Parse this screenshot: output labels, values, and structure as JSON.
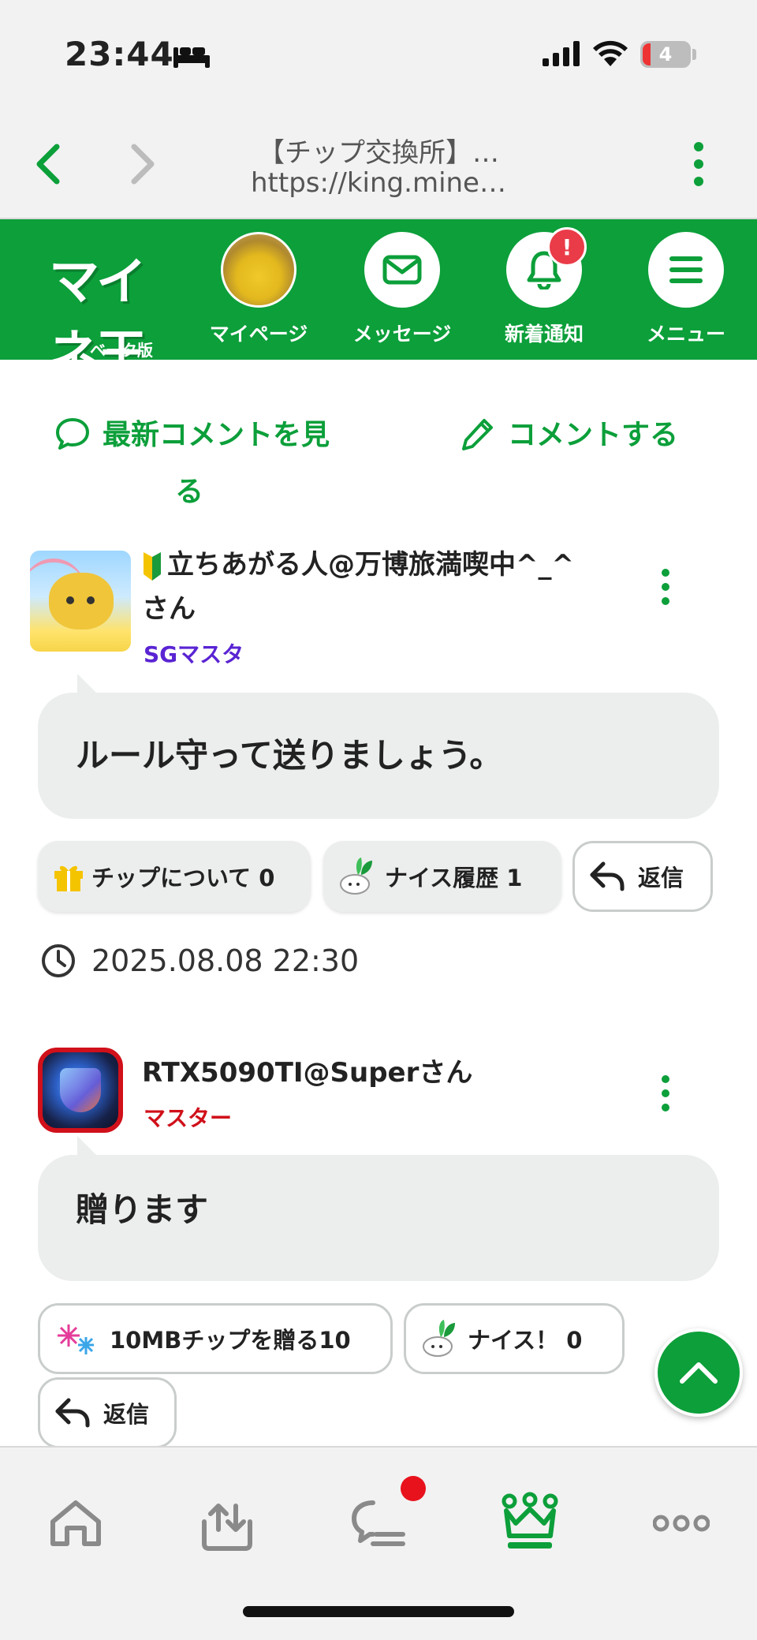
{
  "status_bar": {
    "time": "23:44",
    "battery_level": "4"
  },
  "browser": {
    "title": "【チップ交換所】…",
    "url": "https://king.mine…"
  },
  "header": {
    "logo_text": "マイネ王",
    "logo_beta": "ベータ版",
    "nav": [
      {
        "label": "マイページ"
      },
      {
        "label": "メッセージ"
      },
      {
        "label": "新着通知",
        "badge": "!"
      },
      {
        "label": "メニュー"
      }
    ]
  },
  "comments_header": {
    "latest_line1": "最新コメントを見",
    "latest_line2": "る",
    "comment_label": "コメントする"
  },
  "comments": [
    {
      "username_line1": "立ちあがる人@万博旅満喫中^_^",
      "username_line2": "さん",
      "rank": "SGマスタ",
      "body": "ルール守って送りましょう。",
      "actions": {
        "chip": "チップについて 0",
        "nice_history": "ナイス履歴  1",
        "reply": "返信"
      },
      "timestamp": "2025.08.08 22:30"
    },
    {
      "username": "RTX5090TI@Superさん",
      "rank": "マスター",
      "body": "贈ります",
      "actions": {
        "gift": "10MBチップを贈る10",
        "nice": "ナイス！  0",
        "reply": "返信"
      }
    }
  ],
  "colors": {
    "brand_green": "#0c9f3a",
    "rank_sg": "#5a24d3",
    "rank_master": "#d0101a",
    "badge_red": "#ea3b48"
  }
}
